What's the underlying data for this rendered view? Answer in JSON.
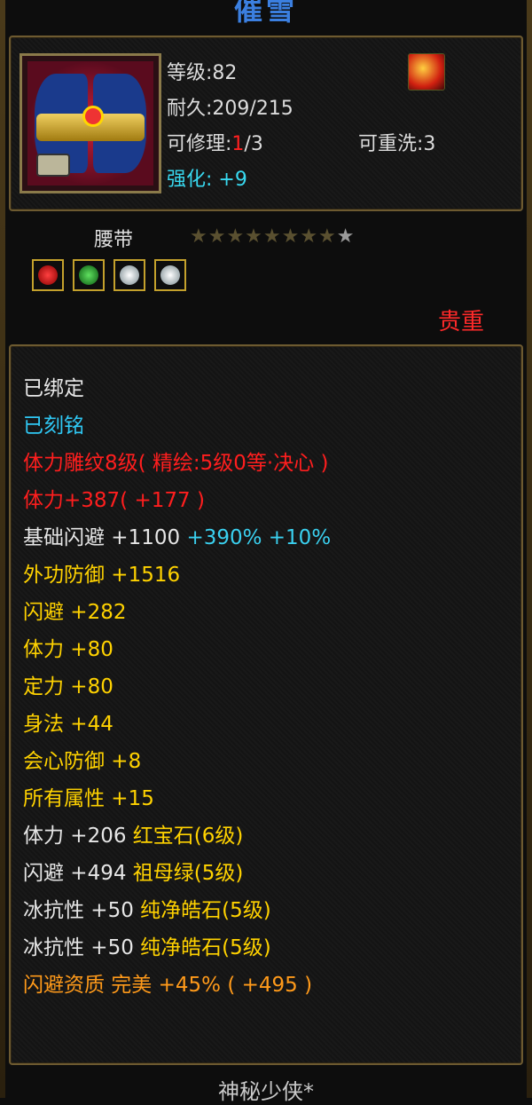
{
  "title": "催雪",
  "header": {
    "level_label": "等级:82",
    "durability_label": "耐久:209/215",
    "repair_label": "可修理:",
    "repair_current": "1",
    "repair_max": "/3",
    "rewash_label": "可重洗:3",
    "enhance_label": "强化:",
    "enhance_value": "+9"
  },
  "item": {
    "name": "腰带",
    "stars_filled": "★★★★★★★★",
    "stars_empty": "★",
    "rarity": "贵重",
    "gem_icons": [
      "red-gem-icon",
      "green-gem-icon",
      "white-gem-icon",
      "white-gem-icon"
    ]
  },
  "lines": [
    {
      "text": "已绑定"
    },
    {
      "text": "已刻铭"
    },
    {
      "text": "体力雕纹8级( 精绘:5级0等·决心 )"
    },
    {
      "text": "体力+387( +177 )"
    },
    {
      "text": "基础闪避 +1100",
      "extra": "+390% +10%"
    },
    {
      "text": "外功防御 +1516"
    },
    {
      "text": "闪避 +282"
    },
    {
      "text": "体力 +80"
    },
    {
      "text": "定力 +80"
    },
    {
      "text": "身法 +44"
    },
    {
      "text": "会心防御 +8"
    },
    {
      "text": "所有属性 +15"
    },
    {
      "text": "体力 +206",
      "extra": "红宝石(6级)"
    },
    {
      "text": "闪避 +494",
      "extra": "祖母绿(5级)"
    },
    {
      "text": "冰抗性 +50",
      "extra": "纯净皓石(5级)"
    },
    {
      "text": "冰抗性 +50",
      "extra": "纯净皓石(5级)"
    },
    {
      "text": "闪避资质 完美 +45% ( +495 )"
    }
  ],
  "footer": "神秘少侠*",
  "colors": {
    "title": "#3b7fe0",
    "rarity": "#ff2a2a",
    "bound": "#e6e6e6",
    "engraved": "#2fc8f4",
    "carving": "#ff1e1e",
    "stat": "#ffd200",
    "base_label": "#e6e6e6",
    "aptitude": "#ff9a1a",
    "enhance": "#38d9f0"
  }
}
